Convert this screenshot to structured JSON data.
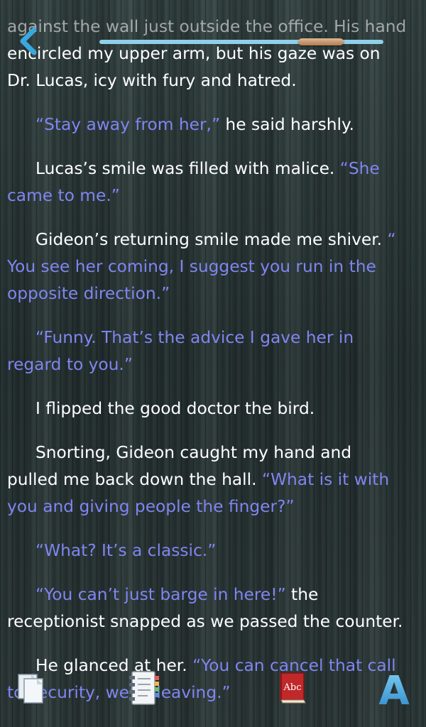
{
  "reader": {
    "paragraphs": [
      {
        "lines": [
          [
            {
              "t": "against the wall just outside the office. His hand",
              "q": false
            }
          ],
          [
            {
              "t": " encircled my upper arm, but his gaze was on",
              "q": false
            }
          ],
          [
            {
              "t": "Dr. Lucas, icy with fury and hatred.",
              "q": false
            }
          ]
        ]
      },
      {
        "lines": [
          [
            {
              "t": "“Stay away from her,”",
              "q": true
            },
            {
              "t": " he said harshly.",
              "q": false
            }
          ]
        ]
      },
      {
        "lines": [
          [
            {
              "t": "Lucas’s smile was filled with malice. ",
              "q": false
            },
            {
              "t": "“She",
              "q": true
            }
          ],
          [
            {
              "t": "came to me.”",
              "q": true
            }
          ]
        ]
      },
      {
        "lines": [
          [
            {
              "t": "Gideon’s returning smile made me shiver. ",
              "q": false
            },
            {
              "t": "“",
              "q": true
            }
          ],
          [
            {
              "t": "You see her coming, I suggest you run in the",
              "q": true
            }
          ],
          [
            {
              "t": "opposite direction.”",
              "q": true
            }
          ]
        ]
      },
      {
        "lines": [
          [
            {
              "t": "“Funny. That’s the advice I gave her in",
              "q": true
            }
          ],
          [
            {
              "t": "regard to you.”",
              "q": true
            }
          ]
        ]
      },
      {
        "lines": [
          [
            {
              "t": "I flipped the good doctor the bird.",
              "q": false
            }
          ]
        ]
      },
      {
        "lines": [
          [
            {
              "t": "Snorting, Gideon caught my hand and",
              "q": false
            }
          ],
          [
            {
              "t": "pulled me back down the hall. ",
              "q": false
            },
            {
              "t": "“What is it with",
              "q": true
            }
          ],
          [
            {
              "t": "you and giving people the finger?”",
              "q": true
            }
          ]
        ]
      },
      {
        "lines": [
          [
            {
              "t": "“What? It’s a classic.”",
              "q": true
            }
          ]
        ]
      },
      {
        "lines": [
          [
            {
              "t": "“You can’t just barge in here!”",
              "q": true
            },
            {
              "t": " the",
              "q": false
            }
          ],
          [
            {
              "t": "receptionist snapped as we passed the counter.",
              "q": false
            }
          ]
        ]
      },
      {
        "lines": [
          [
            {
              "t": "He glanced at her. ",
              "q": false
            },
            {
              "t": "“You can cancel that call",
              "q": true
            }
          ],
          [
            {
              "t": "to security, we’re leaving.”",
              "q": true
            }
          ]
        ]
      }
    ]
  },
  "progress": {
    "fraction": 0.78
  },
  "icons": {
    "back": "chevron-left-icon",
    "pages": "pages-icon",
    "toc": "table-of-contents-icon",
    "dictionary": "dictionary-book-icon",
    "font": "font-size-icon"
  },
  "dictionary_label": "Abc",
  "font_label": "A",
  "colors": {
    "quote": "#7f86f0",
    "text": "#ffffff",
    "accent": "#8fd0e8",
    "thumb": "#c8946a"
  }
}
